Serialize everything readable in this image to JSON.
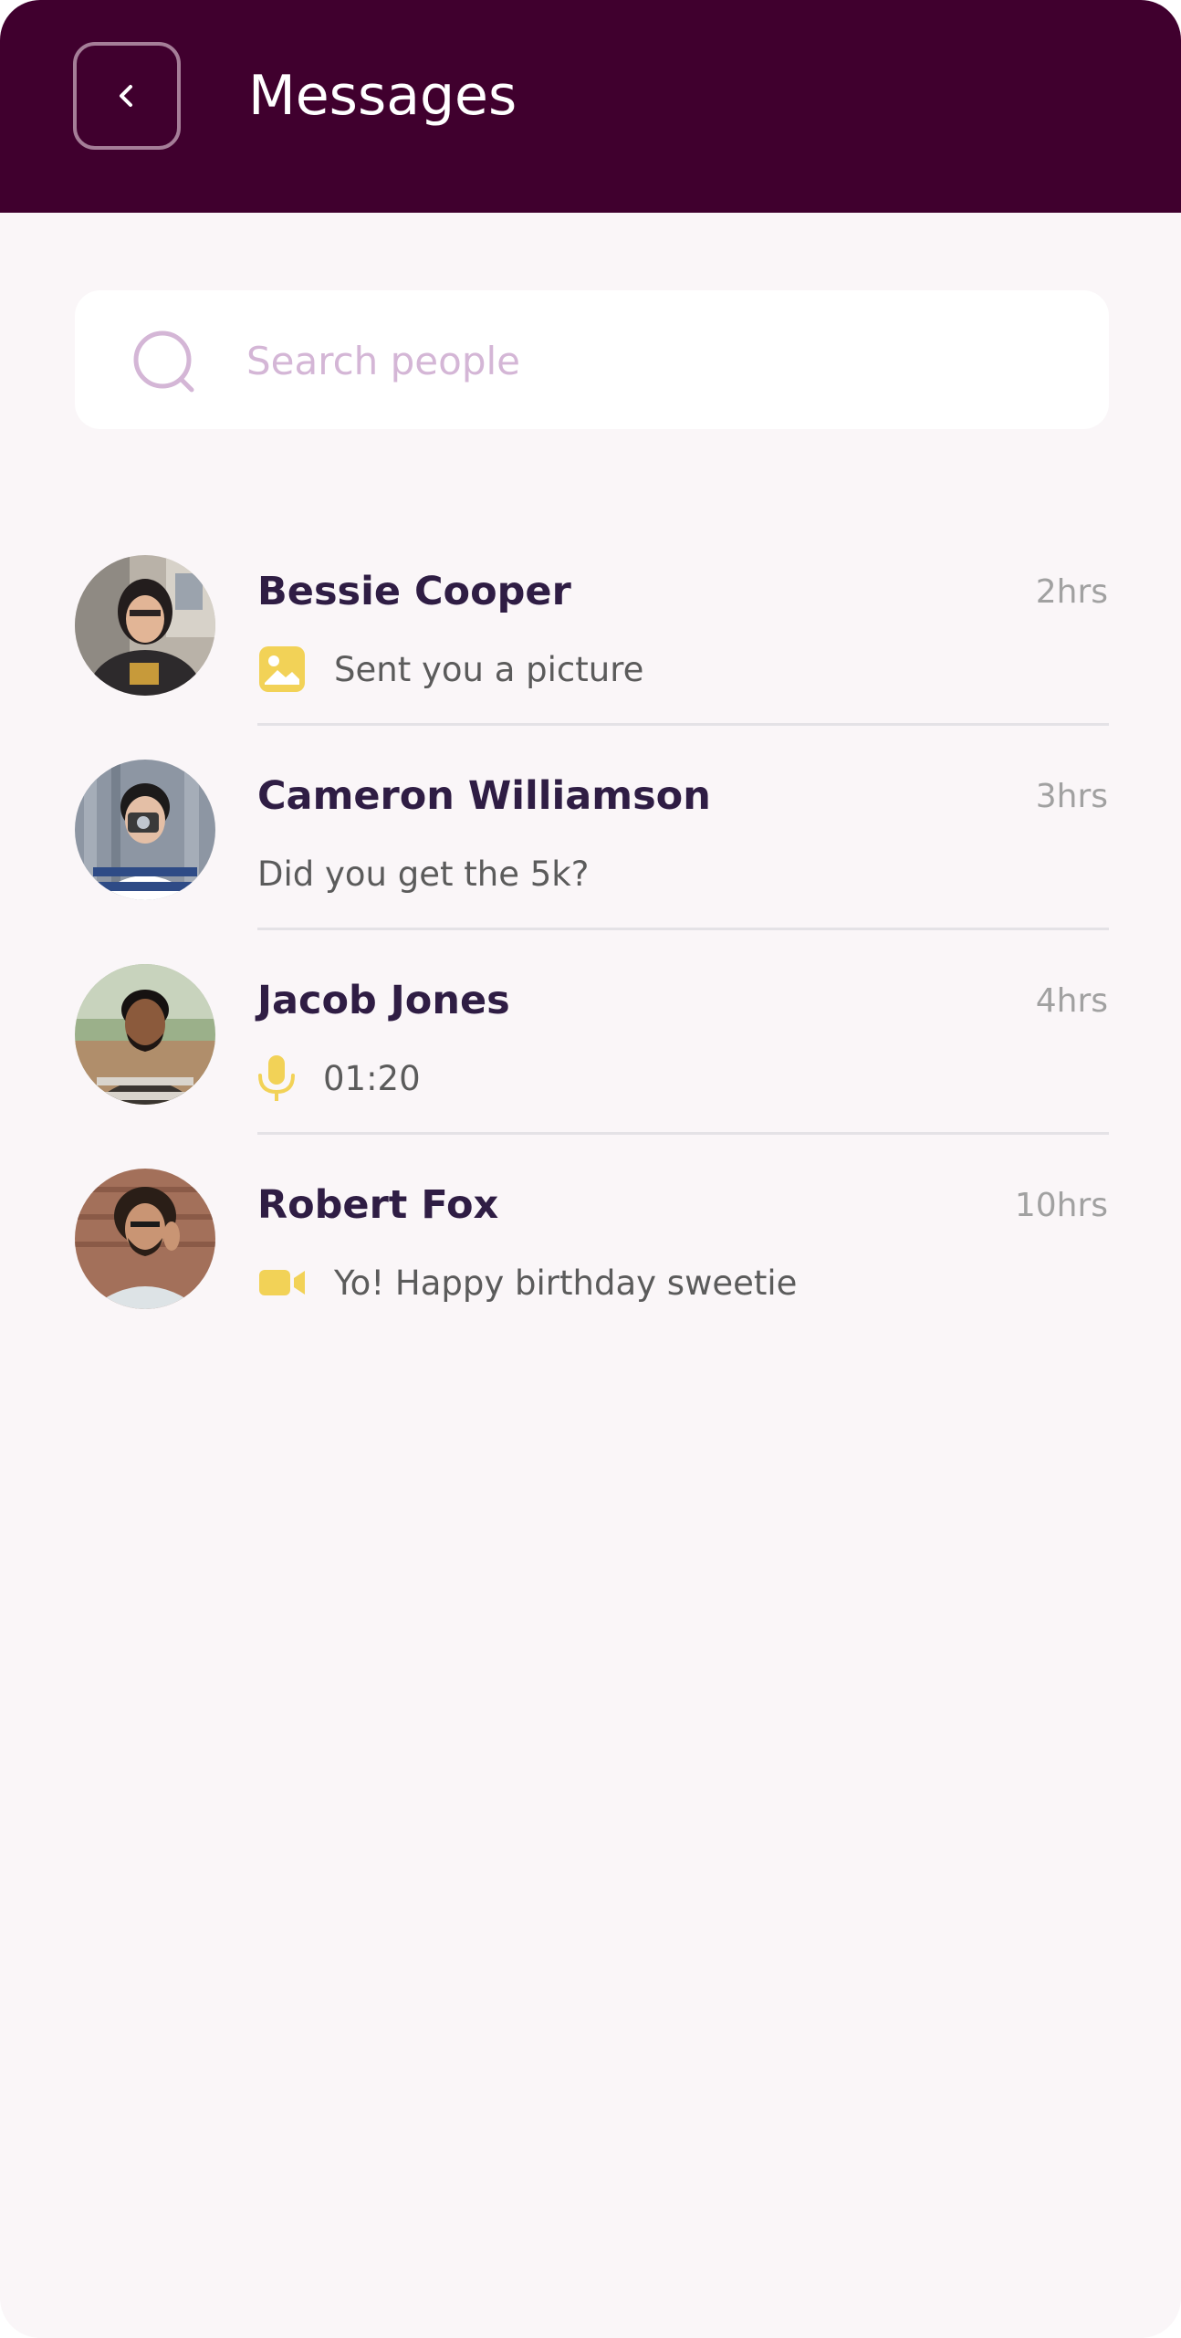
{
  "header": {
    "title": "Messages",
    "back_icon": "chevron-left-icon",
    "background_color": "#40002e"
  },
  "search": {
    "placeholder": "Search people",
    "value": "",
    "icon": "search-icon"
  },
  "conversations": [
    {
      "name": "Bessie Cooper",
      "time": "2hrs",
      "preview_icon": "image-icon",
      "preview_text": "Sent you a picture"
    },
    {
      "name": "Cameron Williamson",
      "time": "3hrs",
      "preview_icon": "",
      "preview_text": "Did you get the 5k?"
    },
    {
      "name": "Jacob Jones",
      "time": "4hrs",
      "preview_icon": "microphone-icon",
      "preview_text": "01:20"
    },
    {
      "name": "Robert Fox",
      "time": "10hrs",
      "preview_icon": "video-camera-icon",
      "preview_text": "Yo! Happy birthday sweetie"
    }
  ],
  "colors": {
    "background": "#faf6f8",
    "accent_icon": "#f2d257",
    "name_text": "#2f1d44",
    "placeholder": "#d4b6d6"
  }
}
